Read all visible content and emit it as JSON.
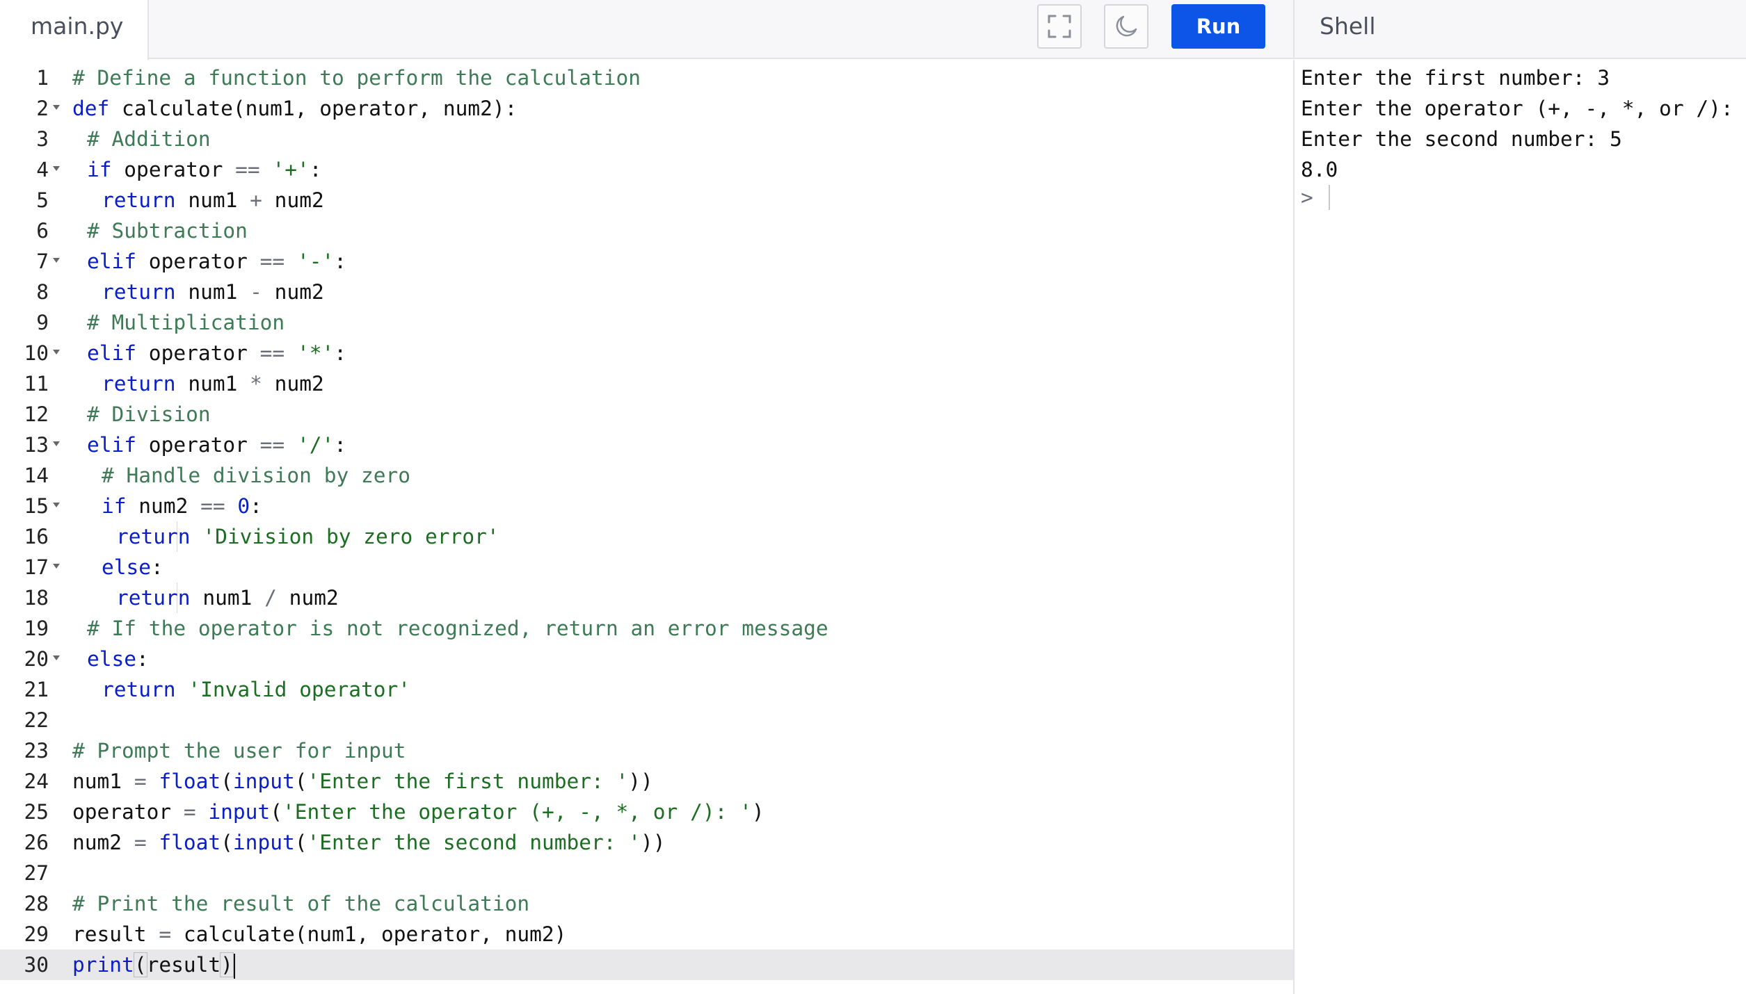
{
  "editor": {
    "file_tab": "main.py",
    "buttons": {
      "fullscreen_icon": "fullscreen-icon",
      "theme_icon": "moon-icon",
      "run_label": "Run"
    },
    "fold_lines": [
      2,
      4,
      7,
      10,
      13,
      15,
      17,
      20
    ],
    "lines": [
      {
        "n": "1",
        "indent": 0,
        "tokens": [
          [
            "comment",
            "# Define a function to perform the calculation"
          ]
        ]
      },
      {
        "n": "2",
        "indent": 0,
        "tokens": [
          [
            "keyword",
            "def"
          ],
          [
            "name",
            " calculate(num1, operator, num2):"
          ]
        ]
      },
      {
        "n": "3",
        "indent": 1,
        "tokens": [
          [
            "comment",
            "# Addition"
          ]
        ]
      },
      {
        "n": "4",
        "indent": 1,
        "tokens": [
          [
            "keyword",
            "if"
          ],
          [
            "name",
            " operator "
          ],
          [
            "op",
            "=="
          ],
          [
            "name",
            " "
          ],
          [
            "string",
            "'+'"
          ],
          [
            "name",
            ":"
          ]
        ]
      },
      {
        "n": "5",
        "indent": 2,
        "tokens": [
          [
            "keyword",
            "return"
          ],
          [
            "name",
            " num1 "
          ],
          [
            "op",
            "+"
          ],
          [
            "name",
            " num2"
          ]
        ]
      },
      {
        "n": "6",
        "indent": 1,
        "tokens": [
          [
            "comment",
            "# Subtraction"
          ]
        ]
      },
      {
        "n": "7",
        "indent": 1,
        "tokens": [
          [
            "keyword",
            "elif"
          ],
          [
            "name",
            " operator "
          ],
          [
            "op",
            "=="
          ],
          [
            "name",
            " "
          ],
          [
            "string",
            "'-'"
          ],
          [
            "name",
            ":"
          ]
        ]
      },
      {
        "n": "8",
        "indent": 2,
        "tokens": [
          [
            "keyword",
            "return"
          ],
          [
            "name",
            " num1 "
          ],
          [
            "op",
            "-"
          ],
          [
            "name",
            " num2"
          ]
        ]
      },
      {
        "n": "9",
        "indent": 1,
        "tokens": [
          [
            "comment",
            "# Multiplication"
          ]
        ]
      },
      {
        "n": "10",
        "indent": 1,
        "tokens": [
          [
            "keyword",
            "elif"
          ],
          [
            "name",
            " operator "
          ],
          [
            "op",
            "=="
          ],
          [
            "name",
            " "
          ],
          [
            "string",
            "'*'"
          ],
          [
            "name",
            ":"
          ]
        ]
      },
      {
        "n": "11",
        "indent": 2,
        "tokens": [
          [
            "keyword",
            "return"
          ],
          [
            "name",
            " num1 "
          ],
          [
            "op",
            "*"
          ],
          [
            "name",
            " num2"
          ]
        ]
      },
      {
        "n": "12",
        "indent": 1,
        "tokens": [
          [
            "comment",
            "# Division"
          ]
        ]
      },
      {
        "n": "13",
        "indent": 1,
        "tokens": [
          [
            "keyword",
            "elif"
          ],
          [
            "name",
            " operator "
          ],
          [
            "op",
            "=="
          ],
          [
            "name",
            " "
          ],
          [
            "string",
            "'/'"
          ],
          [
            "name",
            ":"
          ]
        ]
      },
      {
        "n": "14",
        "indent": 2,
        "tokens": [
          [
            "comment",
            "# Handle division by zero"
          ]
        ]
      },
      {
        "n": "15",
        "indent": 2,
        "tokens": [
          [
            "keyword",
            "if"
          ],
          [
            "name",
            " num2 "
          ],
          [
            "op",
            "=="
          ],
          [
            "name",
            " "
          ],
          [
            "number",
            "0"
          ],
          [
            "name",
            ":"
          ]
        ]
      },
      {
        "n": "16",
        "indent": 3,
        "tokens": [
          [
            "keyword",
            "return"
          ],
          [
            "name",
            " "
          ],
          [
            "string",
            "'Division by zero error'"
          ]
        ]
      },
      {
        "n": "17",
        "indent": 2,
        "tokens": [
          [
            "keyword",
            "else"
          ],
          [
            "name",
            ":"
          ]
        ]
      },
      {
        "n": "18",
        "indent": 3,
        "tokens": [
          [
            "keyword",
            "return"
          ],
          [
            "name",
            " num1 "
          ],
          [
            "op",
            "/"
          ],
          [
            "name",
            " num2"
          ]
        ]
      },
      {
        "n": "19",
        "indent": 1,
        "tokens": [
          [
            "comment",
            "# If the operator is not recognized, return an error message"
          ]
        ]
      },
      {
        "n": "20",
        "indent": 1,
        "tokens": [
          [
            "keyword",
            "else"
          ],
          [
            "name",
            ":"
          ]
        ]
      },
      {
        "n": "21",
        "indent": 2,
        "tokens": [
          [
            "keyword",
            "return"
          ],
          [
            "name",
            " "
          ],
          [
            "string",
            "'Invalid operator'"
          ]
        ]
      },
      {
        "n": "22",
        "indent": 0,
        "tokens": []
      },
      {
        "n": "23",
        "indent": 0,
        "tokens": [
          [
            "comment",
            "# Prompt the user for input"
          ]
        ]
      },
      {
        "n": "24",
        "indent": 0,
        "tokens": [
          [
            "name",
            "num1 "
          ],
          [
            "op",
            "="
          ],
          [
            "name",
            " "
          ],
          [
            "builtin",
            "float"
          ],
          [
            "name",
            "("
          ],
          [
            "builtin",
            "input"
          ],
          [
            "name",
            "("
          ],
          [
            "string",
            "'Enter the first number: '"
          ],
          [
            "name",
            "))"
          ]
        ]
      },
      {
        "n": "25",
        "indent": 0,
        "tokens": [
          [
            "name",
            "operator "
          ],
          [
            "op",
            "="
          ],
          [
            "name",
            " "
          ],
          [
            "builtin",
            "input"
          ],
          [
            "name",
            "("
          ],
          [
            "string",
            "'Enter the operator (+, -, *, or /): '"
          ],
          [
            "name",
            ")"
          ]
        ]
      },
      {
        "n": "26",
        "indent": 0,
        "tokens": [
          [
            "name",
            "num2 "
          ],
          [
            "op",
            "="
          ],
          [
            "name",
            " "
          ],
          [
            "builtin",
            "float"
          ],
          [
            "name",
            "("
          ],
          [
            "builtin",
            "input"
          ],
          [
            "name",
            "("
          ],
          [
            "string",
            "'Enter the second number: '"
          ],
          [
            "name",
            "))"
          ]
        ]
      },
      {
        "n": "27",
        "indent": 0,
        "tokens": []
      },
      {
        "n": "28",
        "indent": 0,
        "tokens": [
          [
            "comment",
            "# Print the result of the calculation"
          ]
        ]
      },
      {
        "n": "29",
        "indent": 0,
        "tokens": [
          [
            "name",
            "result "
          ],
          [
            "op",
            "="
          ],
          [
            "name",
            " calculate(num1, operator, num2)"
          ]
        ]
      },
      {
        "n": "30",
        "indent": 0,
        "tokens": [
          [
            "builtin",
            "print"
          ],
          [
            "bracket",
            "("
          ],
          [
            "name",
            "result"
          ],
          [
            "bracket",
            ")"
          ]
        ]
      }
    ],
    "active_line": "30"
  },
  "shell": {
    "title": "Shell",
    "output": [
      "Enter the first number: 3",
      "Enter the operator (+, -, *, or /): +",
      "Enter the second number: 5",
      "8.0"
    ],
    "prompt": ">"
  }
}
